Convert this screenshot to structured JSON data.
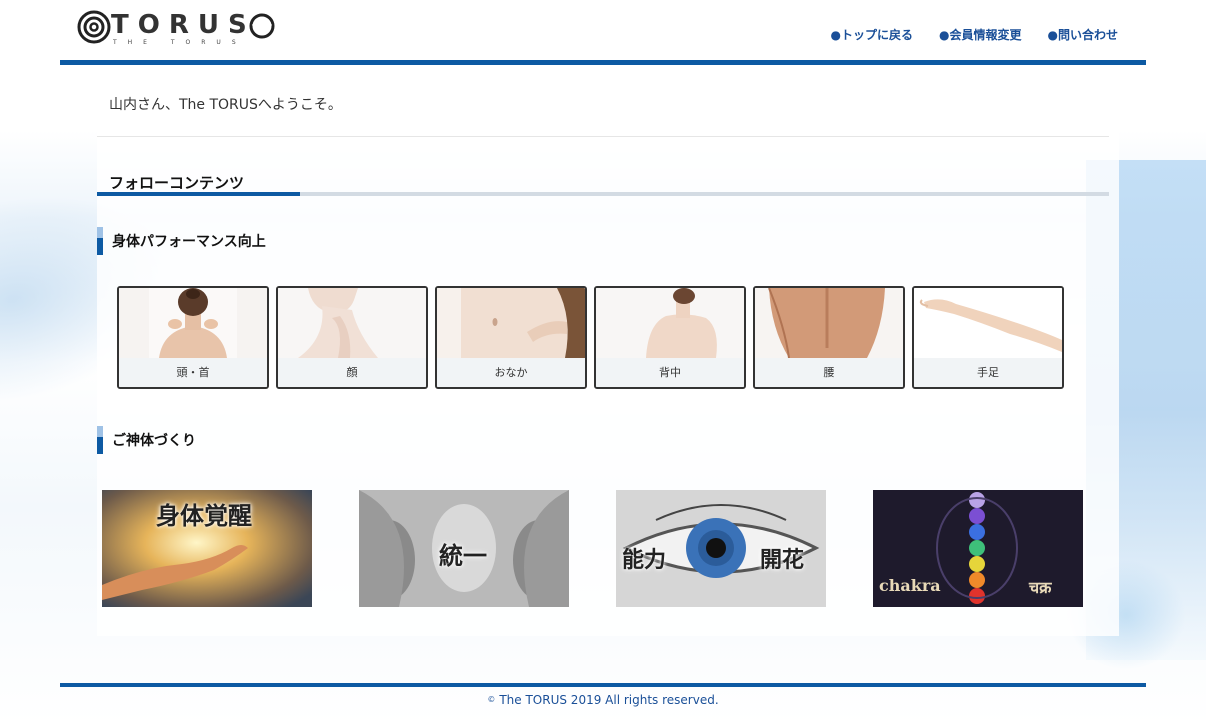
{
  "brand": {
    "name": "TORUS",
    "tagline": "THE TORUS"
  },
  "nav": {
    "items": [
      {
        "label": "●トップに戻る"
      },
      {
        "label": "●会員情報変更"
      },
      {
        "label": "●問い合わせ"
      }
    ]
  },
  "welcome": "山内さん、The TORUSへようこそ。",
  "section": {
    "title": "フォローコンテンツ"
  },
  "performance": {
    "heading": "身体パフォーマンス向上",
    "cards": [
      {
        "label": "頭・首"
      },
      {
        "label": "顔"
      },
      {
        "label": "おなか"
      },
      {
        "label": "背中"
      },
      {
        "label": "腰"
      },
      {
        "label": "手足"
      }
    ]
  },
  "bodybuilding": {
    "heading": "ご神体づくり",
    "banners": [
      {
        "text": "身体覚醒"
      },
      {
        "text": "統一"
      },
      {
        "text_left": "能力",
        "text_right": "開花"
      },
      {
        "text_left": "chakra",
        "text_right": "चक्र"
      }
    ]
  },
  "footer": {
    "copyright_symbol": "©",
    "text": "The TORUS 2019 All rights reserved."
  },
  "colors": {
    "accent": "#0d5aa3",
    "link": "#1a4f98"
  }
}
